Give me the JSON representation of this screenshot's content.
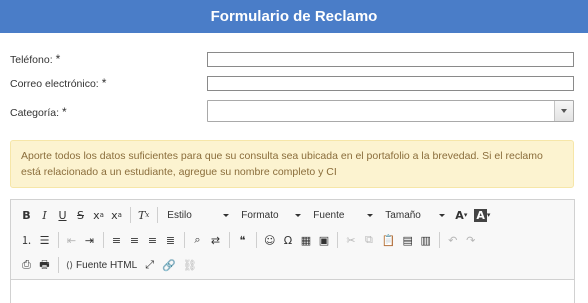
{
  "header": {
    "title": "Formulario de Reclamo"
  },
  "form": {
    "telefono": {
      "label": "Teléfono:",
      "required": "*",
      "value": ""
    },
    "correo": {
      "label": "Correo electrónico:",
      "required": "*",
      "value": ""
    },
    "categoria": {
      "label": "Categoría:",
      "required": "*",
      "selected": ""
    }
  },
  "notice": {
    "text": "Aporte todos los datos suficientes para que su consulta sea ubicada en el portafolio a la brevedad. Si el reclamo está relacionado a un estudiante, agregue su nombre completo y CI"
  },
  "editor": {
    "combos": {
      "style": "Estilo",
      "format": "Formato",
      "font": "Fuente",
      "size": "Tamaño"
    },
    "source_label": "Fuente HTML",
    "colors": {
      "header": "#4a7dc8",
      "notice_bg": "#fcf3d0",
      "notice_text": "#8a6d3b"
    },
    "icons": [
      "bold-icon",
      "italic-icon",
      "underline-icon",
      "strikethrough-icon",
      "subscript-icon",
      "superscript-icon",
      "remove-format-icon",
      "text-color-icon",
      "background-color-icon",
      "numbered-list-icon",
      "bulleted-list-icon",
      "outdent-icon",
      "indent-icon",
      "align-left-icon",
      "align-center-icon",
      "align-right-icon",
      "justify-icon",
      "find-icon",
      "replace-icon",
      "blockquote-icon",
      "smiley-icon",
      "special-char-icon",
      "table-icon",
      "image-icon",
      "cut-icon",
      "copy-icon",
      "paste-icon",
      "paste-text-icon",
      "paste-word-icon",
      "undo-icon",
      "redo-icon",
      "preview-icon",
      "print-icon",
      "source-icon",
      "maximize-icon",
      "link-icon",
      "unlink-icon"
    ]
  }
}
